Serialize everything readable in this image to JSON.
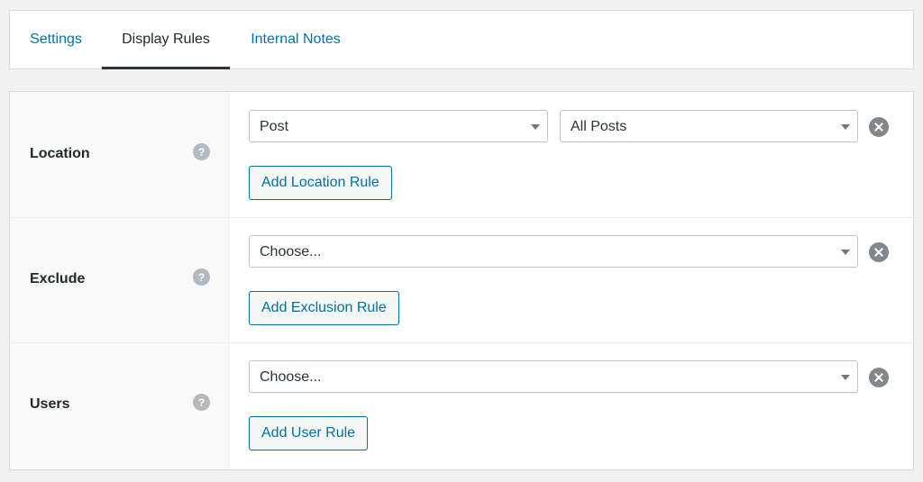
{
  "tabs": [
    {
      "label": "Settings",
      "active": false
    },
    {
      "label": "Display Rules",
      "active": true
    },
    {
      "label": "Internal Notes",
      "active": false
    }
  ],
  "rules": {
    "location": {
      "label": "Location",
      "help_icon": "?",
      "post_type_select": "Post",
      "target_select": "All Posts",
      "add_button": "Add Location Rule"
    },
    "exclude": {
      "label": "Exclude",
      "help_icon": "?",
      "select": "Choose...",
      "add_button": "Add Exclusion Rule"
    },
    "users": {
      "label": "Users",
      "help_icon": "?",
      "select": "Choose...",
      "add_button": "Add User Rule"
    }
  },
  "icons": {
    "help": "help-icon",
    "remove": "remove-icon",
    "dropdown": "chevron-down-icon"
  },
  "colors": {
    "link": "#0073aa",
    "button_accent": "#0071a1",
    "active_tab_underline": "#2c3338",
    "label_bg": "#f9f9f9",
    "page_bg": "#f1f1f1"
  }
}
